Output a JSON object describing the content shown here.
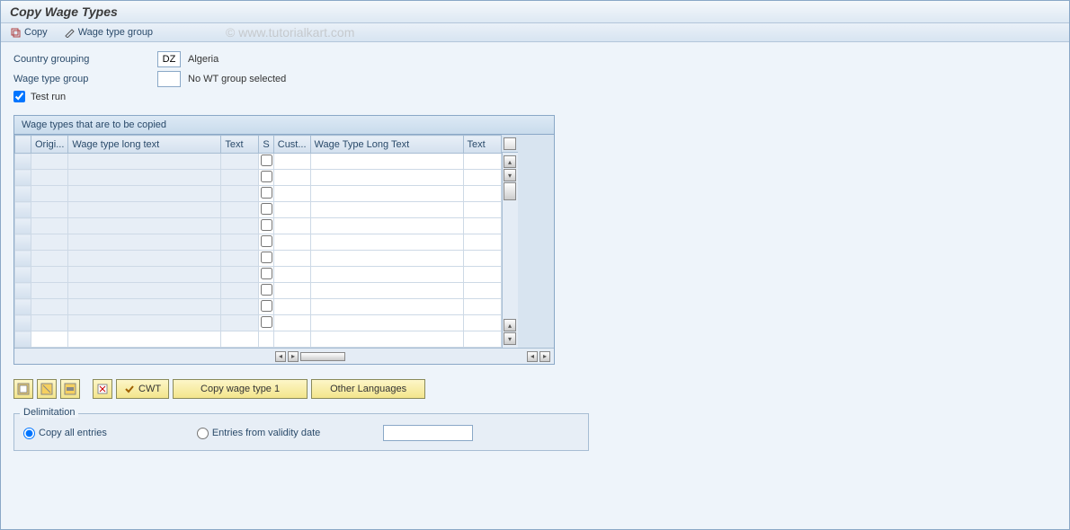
{
  "header": {
    "title": "Copy Wage Types"
  },
  "toolbar": {
    "copy_label": "Copy",
    "wage_type_group_label": "Wage type group",
    "watermark": "© www.tutorialkart.com"
  },
  "form": {
    "country_grouping_label": "Country grouping",
    "country_grouping_value": "DZ",
    "country_grouping_text": "Algeria",
    "wage_type_group_label": "Wage type group",
    "wage_type_group_value": "",
    "wage_type_group_text": "No WT group selected",
    "test_run_label": "Test run",
    "test_run_checked": true
  },
  "table": {
    "title": "Wage types that are to be copied",
    "columns": {
      "origi": "Origi...",
      "long1": "Wage type long text",
      "text1": "Text",
      "s": "S",
      "cust": "Cust...",
      "long2": "Wage Type Long Text",
      "text2": "Text"
    },
    "row_count": 12
  },
  "buttons": {
    "cwt": "CWT",
    "copy_wt1": "Copy wage type 1",
    "other_lang": "Other Languages"
  },
  "delimitation": {
    "title": "Delimitation",
    "copy_all_label": "Copy all entries",
    "from_date_label": "Entries from validity date",
    "selected": "copy_all",
    "date_value": ""
  }
}
